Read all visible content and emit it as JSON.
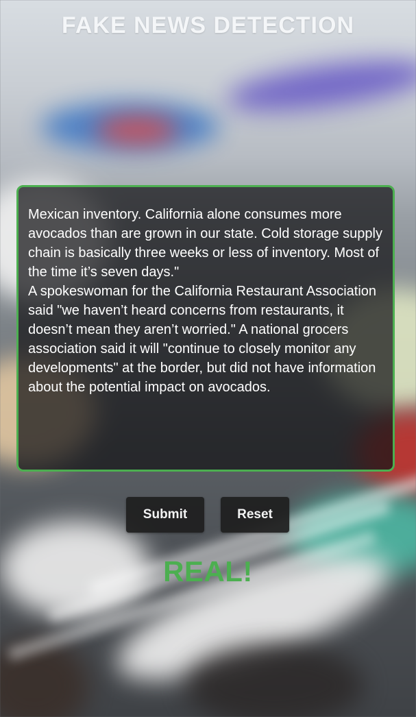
{
  "app": {
    "title": "FAKE NEWS DETECTION"
  },
  "article": {
    "text": "Mexican inventory. California alone consumes more avocados than are grown in our state. Cold storage supply chain is basically three weeks or less of inventory. Most of the time it’s seven days.\"\nA spokeswoman for the California Restaurant Association said \"we haven’t heard concerns from restaurants, it doesn’t mean they aren’t worried.\" A national grocers association said it will \"continue to closely monitor any developments\" at the border, but did not have information about the potential impact on avocados."
  },
  "actions": {
    "submit_label": "Submit",
    "reset_label": "Reset"
  },
  "result": {
    "label": "REAL!",
    "color": "#4caf50"
  },
  "colors": {
    "accent_border": "#4caf50",
    "button_bg": "#1f1f1f",
    "title_text": "#f4f6f8"
  }
}
